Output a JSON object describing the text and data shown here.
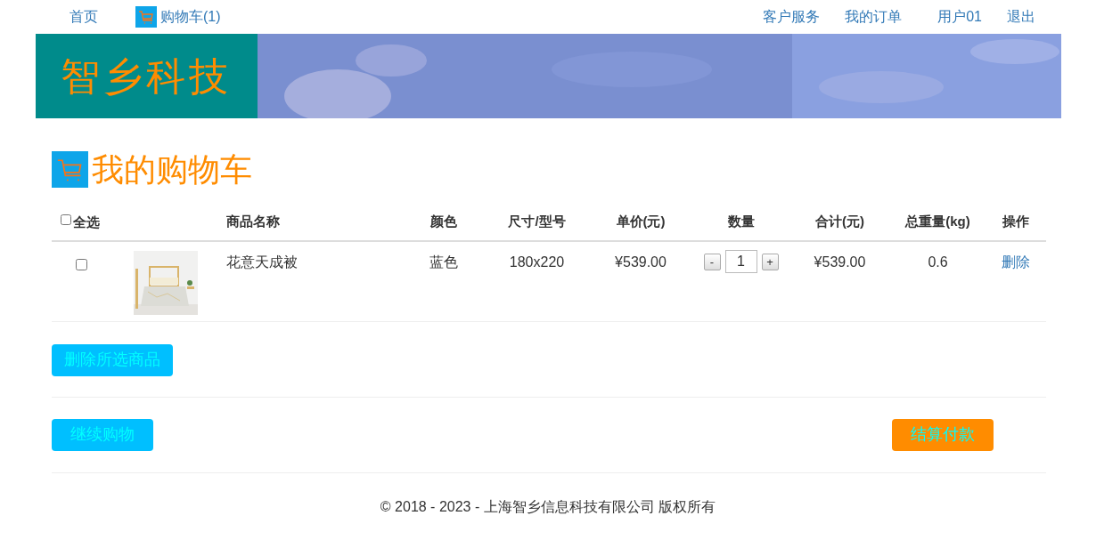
{
  "nav_left": [
    {
      "label": "首页",
      "kind": "link"
    },
    {
      "label": "购物车(1)",
      "kind": "cart"
    }
  ],
  "nav_right": [
    "客户服务",
    "我的订单",
    "用户01",
    "退出"
  ],
  "banner": {
    "logo": "智乡科技"
  },
  "heading": "我的购物车",
  "table": {
    "select_all": {
      "label": "全选",
      "checked": false
    },
    "columns": [
      "",
      "商品名称",
      "颜色",
      "尺寸/型号",
      "单价(元)",
      "数量",
      "合计(元)",
      "总重量(kg)",
      "操作"
    ],
    "rows": [
      {
        "checked": false,
        "name": "花意天成被",
        "color_name": "蓝色",
        "size": "180x220",
        "unit_price": "¥539.00",
        "minus": "-",
        "quantity": "1",
        "plus": "+",
        "total": "¥539.00",
        "weight": "0.6",
        "action": "删除"
      }
    ]
  },
  "delete_selected": "删除所选商品",
  "continue_shopping": "继续购物",
  "checkout": "结算付款",
  "footer": "© 2018 - 2023 - 上海智乡信息科技有限公司 版权所有"
}
